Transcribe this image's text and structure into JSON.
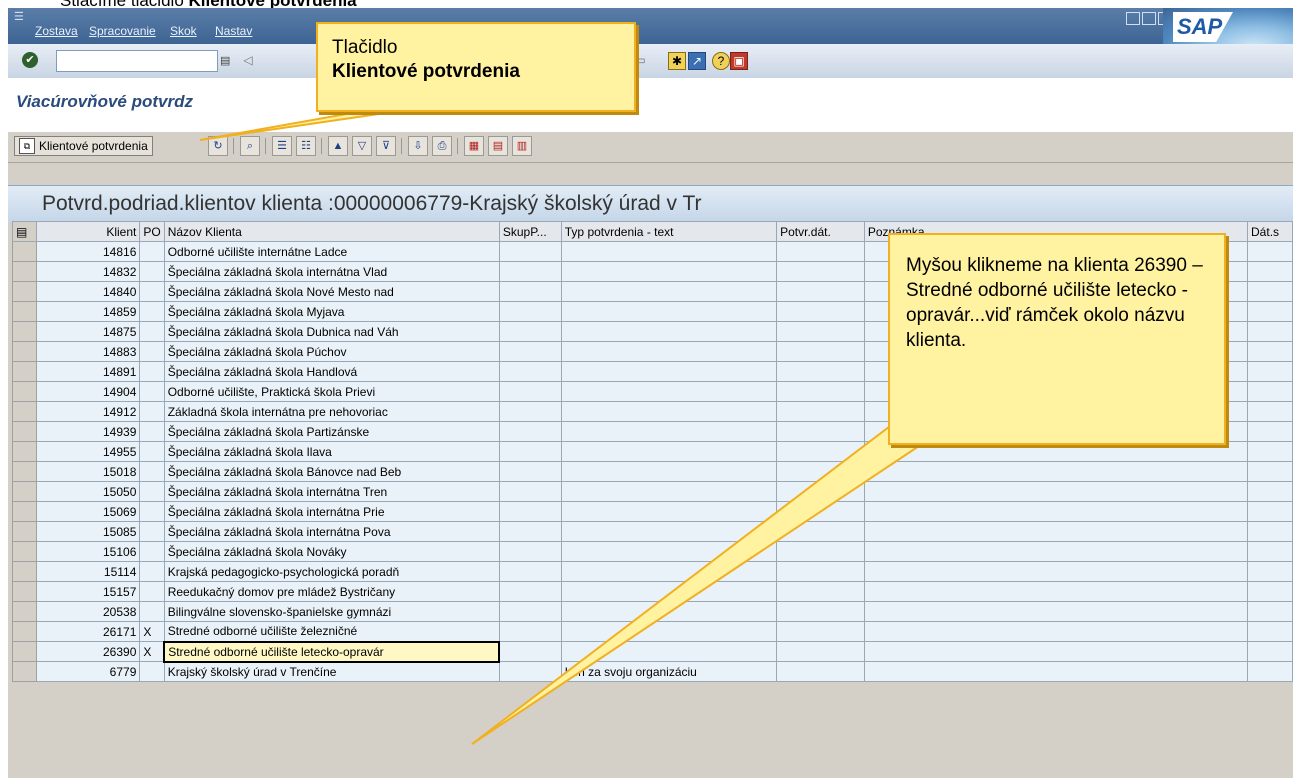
{
  "doc_caption": {
    "prefix": "Stlačíme tlačidlo ",
    "bold": "Klientové potvrdenia"
  },
  "menubar": {
    "items": [
      "Zostava",
      "Spracovanie",
      "Skok",
      "Nastav"
    ]
  },
  "toolbar1": {
    "command_value": ""
  },
  "window_title": "Viacúrovňové potvrdz",
  "toolbar2": {
    "client_button_label": "Klientové potvrdenia"
  },
  "grid": {
    "title": "Potvrd.podriad.klientov klienta :00000006779-Krajský školský úrad v Tr",
    "columns": [
      "Klient",
      "PO",
      "Názov Klienta",
      "SkupP...",
      "Typ potvrdenia - text",
      "Potvr.dát.",
      "Poznámka",
      "Dát.s"
    ],
    "rows": [
      {
        "klient": "14816",
        "po": "",
        "nazov": "Odborné učilište internátne Ladce",
        "typ": ""
      },
      {
        "klient": "14832",
        "po": "",
        "nazov": "Špeciálna základná škola internátna Vlad",
        "typ": ""
      },
      {
        "klient": "14840",
        "po": "",
        "nazov": "Špeciálna základná škola Nové Mesto nad",
        "typ": ""
      },
      {
        "klient": "14859",
        "po": "",
        "nazov": "Špeciálna základná škola Myjava",
        "typ": ""
      },
      {
        "klient": "14875",
        "po": "",
        "nazov": "Špeciálna základná škola Dubnica nad Váh",
        "typ": ""
      },
      {
        "klient": "14883",
        "po": "",
        "nazov": "Špeciálna základná škola Púchov",
        "typ": ""
      },
      {
        "klient": "14891",
        "po": "",
        "nazov": "Špeciálna základná škola Handlová",
        "typ": ""
      },
      {
        "klient": "14904",
        "po": "",
        "nazov": "Odborné učilište, Praktická škola Prievi",
        "typ": ""
      },
      {
        "klient": "14912",
        "po": "",
        "nazov": "Základná škola internátna pre nehovoriac",
        "typ": ""
      },
      {
        "klient": "14939",
        "po": "",
        "nazov": "Špeciálna základná škola Partizánske",
        "typ": ""
      },
      {
        "klient": "14955",
        "po": "",
        "nazov": "Špeciálna základná škola Ilava",
        "typ": ""
      },
      {
        "klient": "15018",
        "po": "",
        "nazov": "Špeciálna základná škola Bánovce nad Beb",
        "typ": ""
      },
      {
        "klient": "15050",
        "po": "",
        "nazov": "Špeciálna základná škola internátna Tren",
        "typ": ""
      },
      {
        "klient": "15069",
        "po": "",
        "nazov": "Špeciálna základná škola internátna Prie",
        "typ": ""
      },
      {
        "klient": "15085",
        "po": "",
        "nazov": "Špeciálna základná škola internátna Pova",
        "typ": ""
      },
      {
        "klient": "15106",
        "po": "",
        "nazov": "Špeciálna základná škola Nováky",
        "typ": ""
      },
      {
        "klient": "15114",
        "po": "",
        "nazov": "Krajská pedagogicko-psychologická poradň",
        "typ": ""
      },
      {
        "klient": "15157",
        "po": "",
        "nazov": "Reedukačný domov pre mládež Bystričany",
        "typ": ""
      },
      {
        "klient": "20538",
        "po": "",
        "nazov": "Bilingválne slovensko-španielske gymnázi",
        "typ": ""
      },
      {
        "klient": "26171",
        "po": "X",
        "nazov": "Stredné odborné učilište železničné",
        "typ": ""
      },
      {
        "klient": "26390",
        "po": "X",
        "nazov": "Stredné odborné učilište letecko-opravár",
        "typ": "",
        "highlight": true
      },
      {
        "klient": "6779",
        "po": "",
        "nazov": "Krajský školský úrad v Trenčíne",
        "typ": "Len za svoju organizáciu"
      }
    ]
  },
  "callouts": {
    "button_hint_line1": "Tlačidlo",
    "button_hint_line2": "Klientové potvrdenia",
    "row_hint": "Myšou klikneme na klienta 26390 – Stredné odborné učilište letecko - opravár...viď rámček okolo názvu klienta."
  },
  "colors": {
    "menubar": "#3e6494",
    "callout_fill": "#fff2a0",
    "callout_border": "#f0b020",
    "grid_cell": "#e9f2f8"
  }
}
